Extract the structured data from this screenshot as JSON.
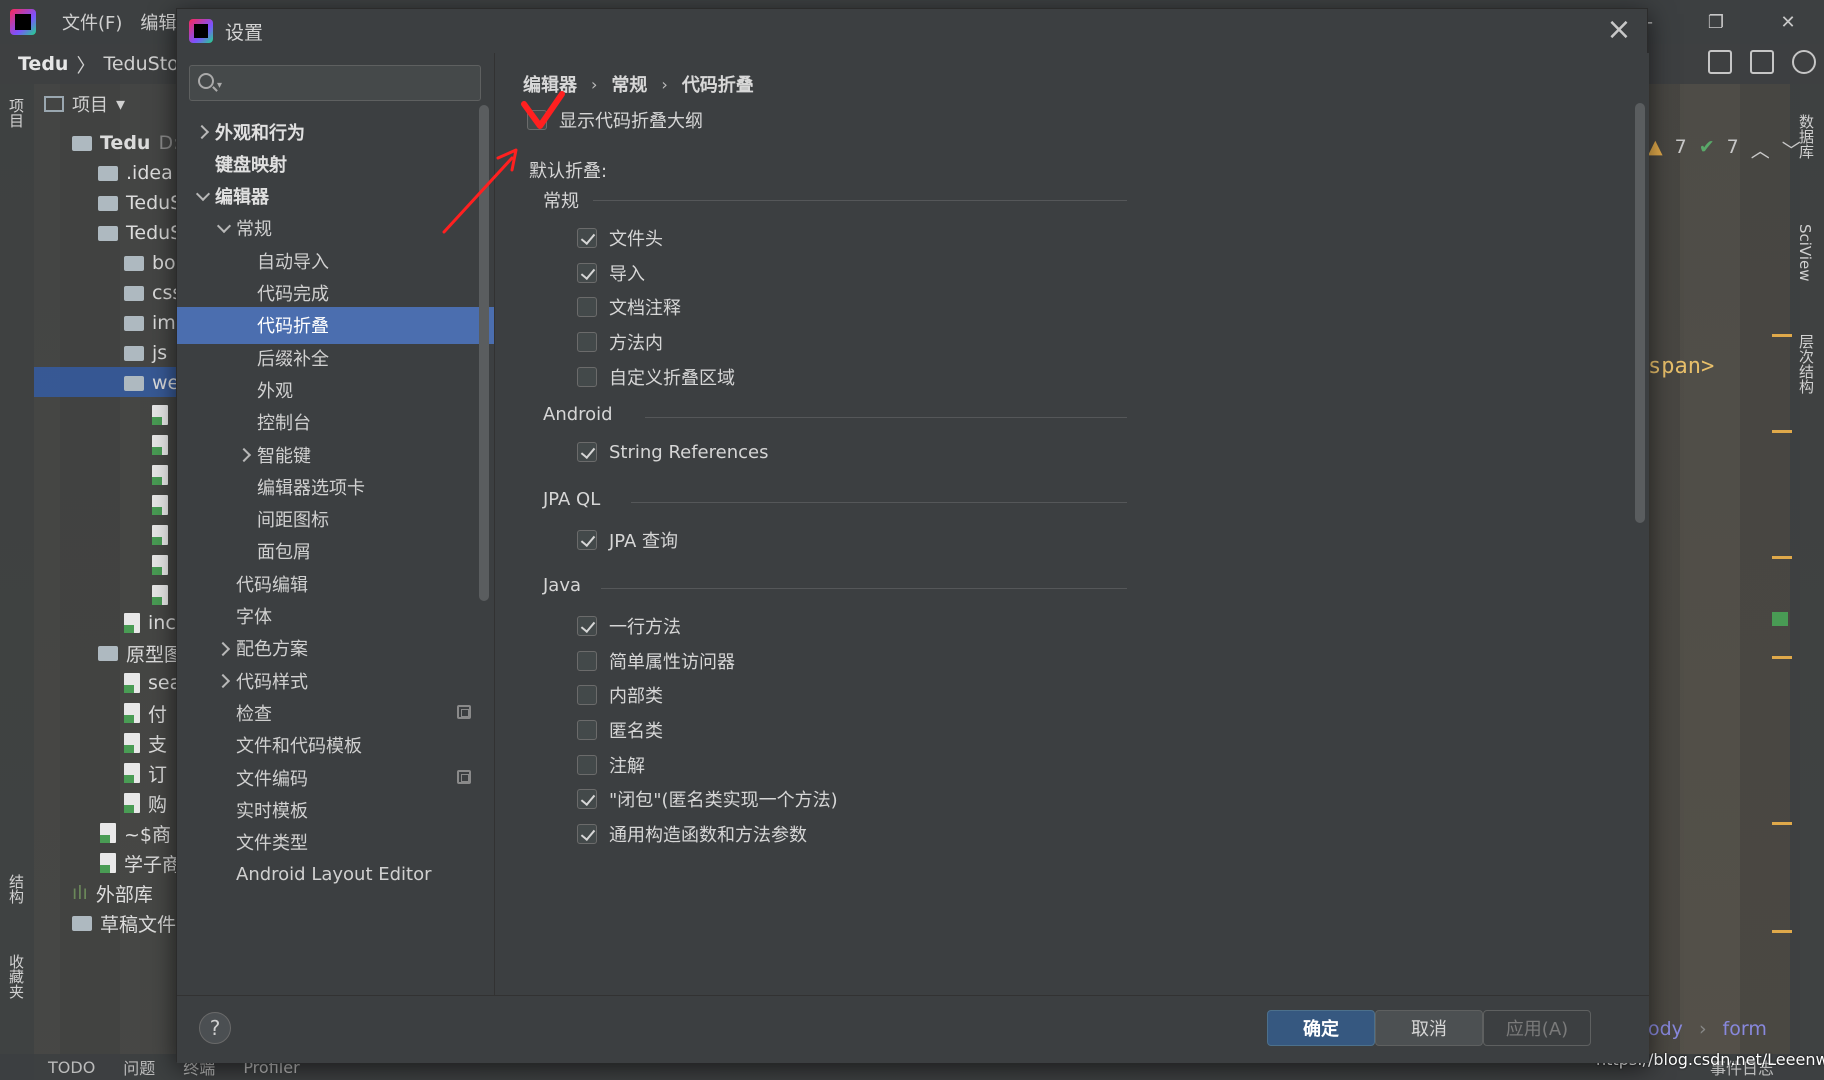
{
  "ide": {
    "menu": [
      "文件(F)",
      "编辑("
    ],
    "breadcrumb": [
      "Tedu",
      "TeduStore"
    ],
    "project_tab": "项目",
    "tree": [
      {
        "label": "Tedu",
        "suffix": "D:"
      },
      {
        "label": ".idea"
      },
      {
        "label": "TeduS"
      },
      {
        "label": "TeduS"
      },
      {
        "label": "bo"
      },
      {
        "label": "css"
      },
      {
        "label": "im"
      },
      {
        "label": "js"
      },
      {
        "label": "we"
      },
      {
        "label": "inc"
      },
      {
        "label": "原型图"
      },
      {
        "label": "sea"
      },
      {
        "label": "付"
      },
      {
        "label": "支"
      },
      {
        "label": "订"
      },
      {
        "label": "购"
      },
      {
        "label": "~$商"
      },
      {
        "label": "学子商"
      },
      {
        "label": "外部库"
      },
      {
        "label": "草稿文件"
      }
    ],
    "left_vertical_tabs": [
      "项目",
      "结构",
      "收藏夹"
    ],
    "right_vertical_tabs": [
      "数据库",
      "SciView",
      "层次结构"
    ],
    "inspection": {
      "warnings": "7",
      "ok": "7"
    },
    "code_fragment": "span>",
    "bottom_crumbs": [
      "ody",
      "form"
    ],
    "status": [
      "TODO",
      "问题",
      "终端",
      "Profiler",
      "事件日志"
    ],
    "watermark": "https://blog.csdn.net/Leeenwen"
  },
  "dialog": {
    "title": "设置",
    "search": {
      "placeholder": "",
      "value": ""
    },
    "nav": [
      {
        "label": "外观和行为",
        "bold": true,
        "chevron": "right"
      },
      {
        "label": "键盘映射",
        "bold": true
      },
      {
        "label": "编辑器",
        "bold": true,
        "chevron": "down"
      },
      {
        "label": "常规",
        "chevron": "down"
      },
      {
        "label": "自动导入"
      },
      {
        "label": "代码完成"
      },
      {
        "label": "代码折叠",
        "selected": true
      },
      {
        "label": "后缀补全"
      },
      {
        "label": "外观"
      },
      {
        "label": "控制台"
      },
      {
        "label": "智能键",
        "chevron": "right"
      },
      {
        "label": "编辑器选项卡"
      },
      {
        "label": "间距图标"
      },
      {
        "label": "面包屑"
      },
      {
        "label": "代码编辑"
      },
      {
        "label": "字体"
      },
      {
        "label": "配色方案",
        "chevron": "right"
      },
      {
        "label": "代码样式",
        "chevron": "right"
      },
      {
        "label": "检查",
        "copy": true
      },
      {
        "label": "文件和代码模板"
      },
      {
        "label": "文件编码",
        "copy": true
      },
      {
        "label": "实时模板"
      },
      {
        "label": "文件类型"
      },
      {
        "label": "Android Layout Editor"
      }
    ],
    "breadcrumb": [
      "编辑器",
      "常规",
      "代码折叠"
    ],
    "show_outline": {
      "label": "显示代码折叠大纲",
      "checked": false
    },
    "default_fold_label": "默认折叠:",
    "groups": [
      {
        "title": "常规",
        "items": [
          {
            "label": "文件头",
            "checked": true
          },
          {
            "label": "导入",
            "checked": true
          },
          {
            "label": "文档注释",
            "checked": false
          },
          {
            "label": "方法内",
            "checked": false
          },
          {
            "label": "自定义折叠区域",
            "checked": false
          }
        ]
      },
      {
        "title": "Android",
        "items": [
          {
            "label": "String References",
            "checked": true
          }
        ]
      },
      {
        "title": "JPA QL",
        "items": [
          {
            "label": "JPA 查询",
            "checked": true
          }
        ]
      },
      {
        "title": "Java",
        "items": [
          {
            "label": "一行方法",
            "checked": true
          },
          {
            "label": "简单属性访问器",
            "checked": false
          },
          {
            "label": "内部类",
            "checked": false
          },
          {
            "label": "匿名类",
            "checked": false
          },
          {
            "label": "注解",
            "checked": false
          },
          {
            "label": "\"闭包\"(匿名类实现一个方法)",
            "checked": true
          },
          {
            "label": "通用构造函数和方法参数",
            "checked": true
          }
        ]
      }
    ],
    "buttons": {
      "help": "?",
      "ok": "确定",
      "cancel": "取消",
      "apply": "应用(A)"
    },
    "colors": {
      "background": "#3c3f41",
      "selection": "#4b6eaf",
      "ok_button": "#365880",
      "annotation": "#ff2020"
    }
  }
}
